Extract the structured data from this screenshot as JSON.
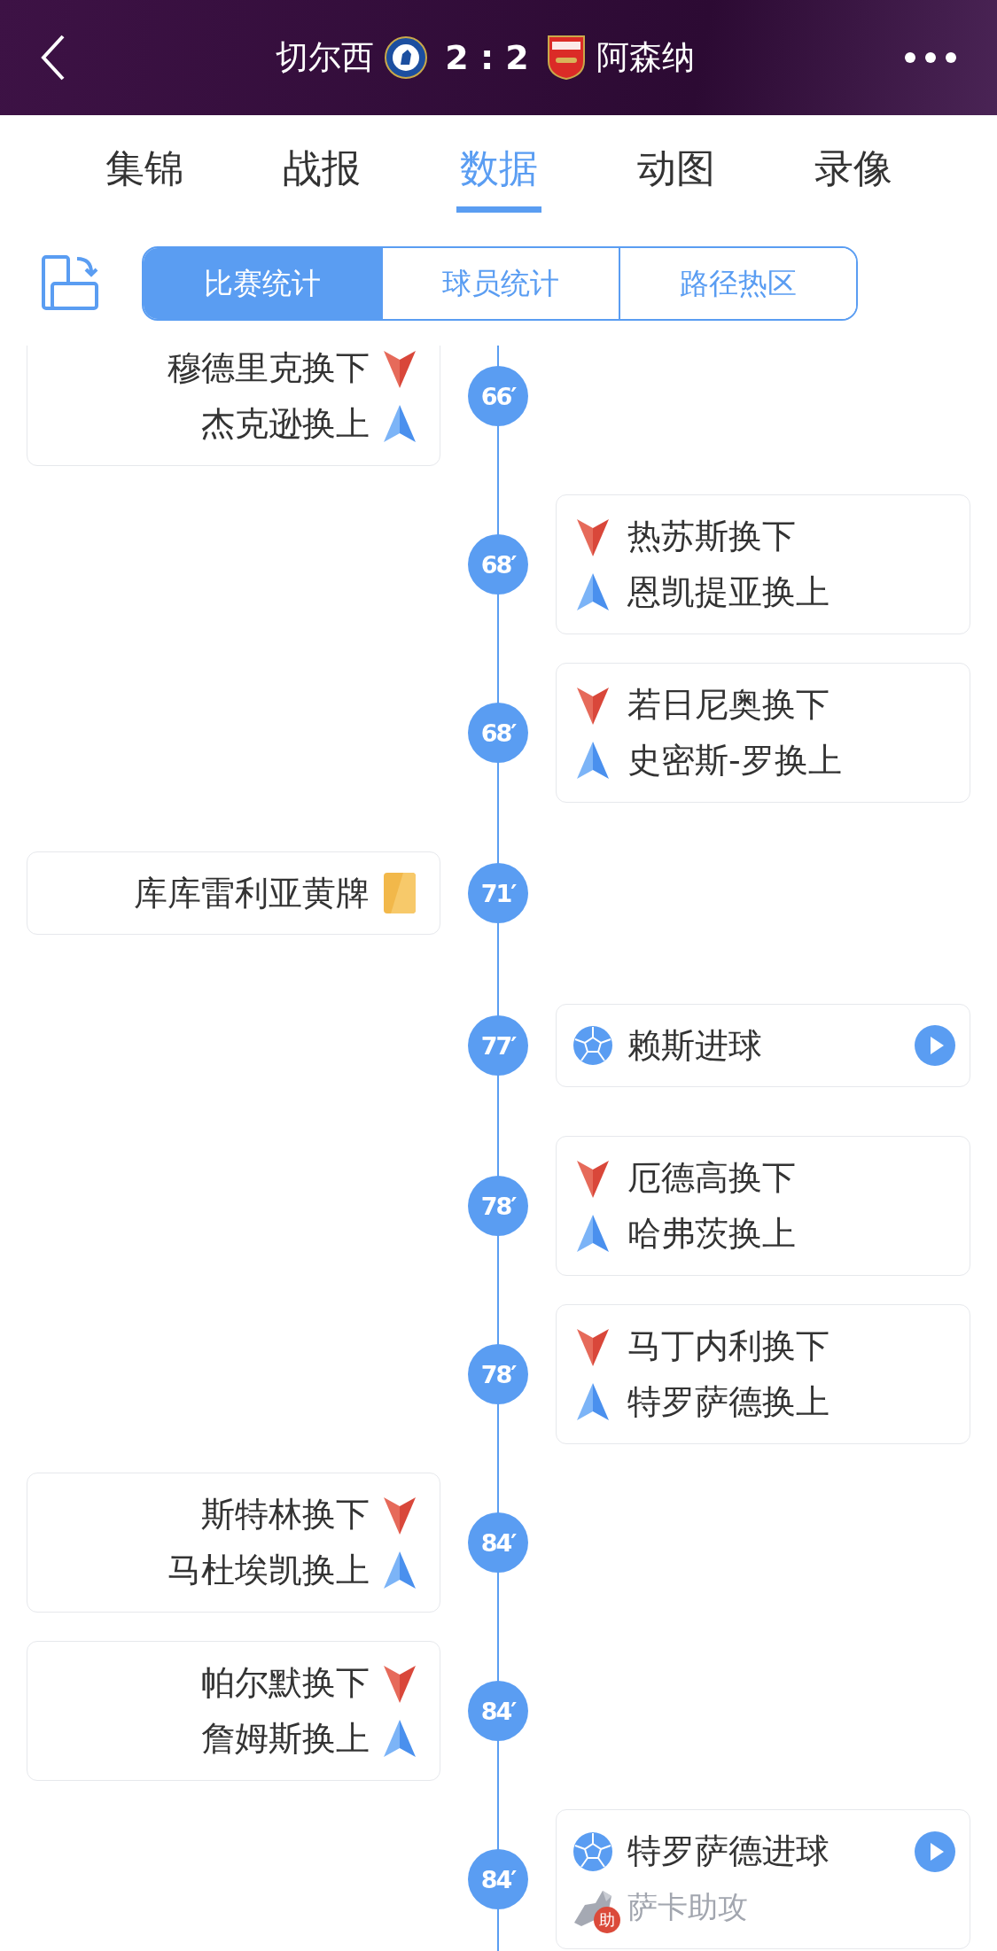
{
  "header": {
    "home_team": "切尔西",
    "score": "2 : 2",
    "away_team": "阿森纳"
  },
  "tabs": [
    {
      "label": "集锦",
      "selected": false
    },
    {
      "label": "战报",
      "selected": false
    },
    {
      "label": "数据",
      "selected": true
    },
    {
      "label": "动图",
      "selected": false
    },
    {
      "label": "录像",
      "selected": false
    }
  ],
  "segments": [
    {
      "label": "比赛统计",
      "selected": true
    },
    {
      "label": "球员统计",
      "selected": false
    },
    {
      "label": "路径热区",
      "selected": false
    }
  ],
  "events": [
    {
      "minute": "66′",
      "home": true,
      "lines": [
        {
          "kind": "sub_out",
          "text": "穆德里克换下"
        },
        {
          "kind": "sub_in",
          "text": "杰克逊换上"
        }
      ]
    },
    {
      "minute": "68′",
      "home": false,
      "lines": [
        {
          "kind": "sub_out",
          "text": "热苏斯换下"
        },
        {
          "kind": "sub_in",
          "text": "恩凯提亚换上"
        }
      ]
    },
    {
      "minute": "68′",
      "home": false,
      "lines": [
        {
          "kind": "sub_out",
          "text": "若日尼奥换下"
        },
        {
          "kind": "sub_in",
          "text": "史密斯-罗换上"
        }
      ]
    },
    {
      "minute": "71′",
      "home": true,
      "lines": [
        {
          "kind": "yellow",
          "text": "库库雷利亚黄牌"
        }
      ]
    },
    {
      "minute": "77′",
      "home": false,
      "video": true,
      "lines": [
        {
          "kind": "goal",
          "text": "赖斯进球"
        }
      ]
    },
    {
      "minute": "78′",
      "home": false,
      "lines": [
        {
          "kind": "sub_out",
          "text": "厄德高换下"
        },
        {
          "kind": "sub_in",
          "text": "哈弗茨换上"
        }
      ]
    },
    {
      "minute": "78′",
      "home": false,
      "lines": [
        {
          "kind": "sub_out",
          "text": "马丁内利换下"
        },
        {
          "kind": "sub_in",
          "text": "特罗萨德换上"
        }
      ]
    },
    {
      "minute": "84′",
      "home": true,
      "lines": [
        {
          "kind": "sub_out",
          "text": "斯特林换下"
        },
        {
          "kind": "sub_in",
          "text": "马杜埃凯换上"
        }
      ]
    },
    {
      "minute": "84′",
      "home": true,
      "lines": [
        {
          "kind": "sub_out",
          "text": "帕尔默换下"
        },
        {
          "kind": "sub_in",
          "text": "詹姆斯换上"
        }
      ]
    },
    {
      "minute": "84′",
      "home": false,
      "video": true,
      "lines": [
        {
          "kind": "goal",
          "text": "特罗萨德进球"
        },
        {
          "kind": "assist",
          "text": "萨卡助攻",
          "badge": "助"
        }
      ]
    }
  ]
}
